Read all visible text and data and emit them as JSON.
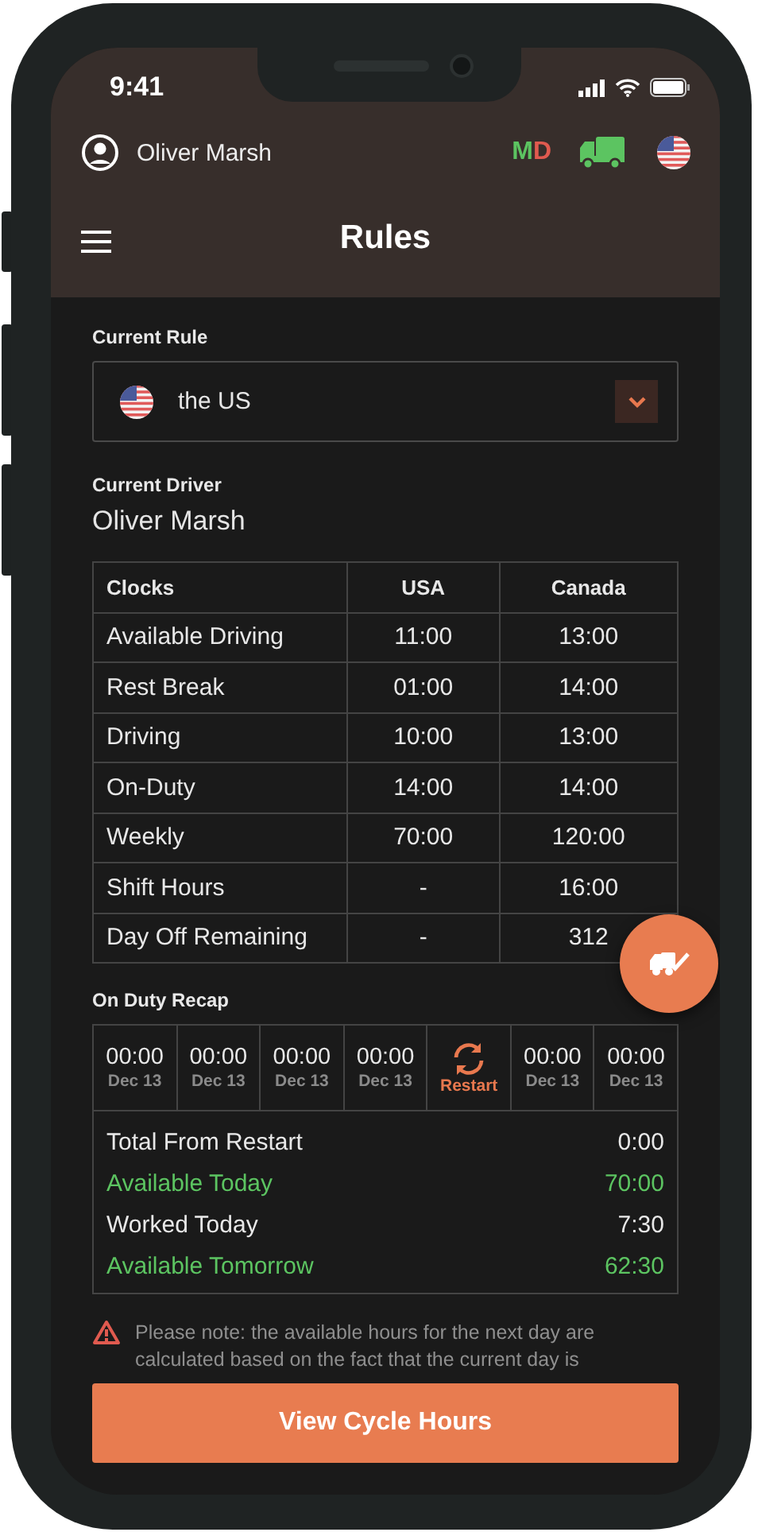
{
  "status_bar": {
    "time": "9:41"
  },
  "user": {
    "name": "Oliver Marsh"
  },
  "status_badge": [
    {
      "text": "M",
      "color": "#5cc461"
    },
    {
      "text": "D",
      "color": "#e05a4f"
    }
  ],
  "title": "Rules",
  "current_rule": {
    "label": "Current Rule",
    "value": "the US"
  },
  "current_driver": {
    "label": "Current Driver",
    "name": "Oliver Marsh"
  },
  "clocks": {
    "columns": [
      "Clocks",
      "USA",
      "Canada"
    ],
    "rows": [
      [
        "Available Driving",
        "11:00",
        "13:00"
      ],
      [
        "Rest Break",
        "01:00",
        "14:00"
      ],
      [
        "Driving",
        "10:00",
        "13:00"
      ],
      [
        "On-Duty",
        "14:00",
        "14:00"
      ],
      [
        "Weekly",
        "70:00",
        "120:00"
      ],
      [
        "Shift Hours",
        "-",
        "16:00"
      ],
      [
        "Day Off Remaining",
        "-",
        "312"
      ]
    ]
  },
  "recap": {
    "title": "On Duty Recap",
    "days": [
      {
        "kind": "day",
        "time": "00:00",
        "date": "Dec 13"
      },
      {
        "kind": "day",
        "time": "00:00",
        "date": "Dec 13"
      },
      {
        "kind": "day",
        "time": "00:00",
        "date": "Dec 13"
      },
      {
        "kind": "day",
        "time": "00:00",
        "date": "Dec 13"
      },
      {
        "kind": "restart",
        "label": "Restart"
      },
      {
        "kind": "day",
        "time": "00:00",
        "date": "Dec 13"
      },
      {
        "kind": "day",
        "time": "00:00",
        "date": "Dec 13"
      }
    ],
    "totals": [
      {
        "label": "Total From Restart",
        "value": "0:00",
        "highlight": false
      },
      {
        "label": "Available Today",
        "value": "70:00",
        "highlight": true
      },
      {
        "label": "Worked Today",
        "value": "7:30",
        "highlight": false
      },
      {
        "label": "Available Tomorrow",
        "value": "62:30",
        "highlight": true
      }
    ]
  },
  "note": "Please note: the available hours for the next day are calculated based on the fact that the current day is",
  "button": "View Cycle Hours"
}
